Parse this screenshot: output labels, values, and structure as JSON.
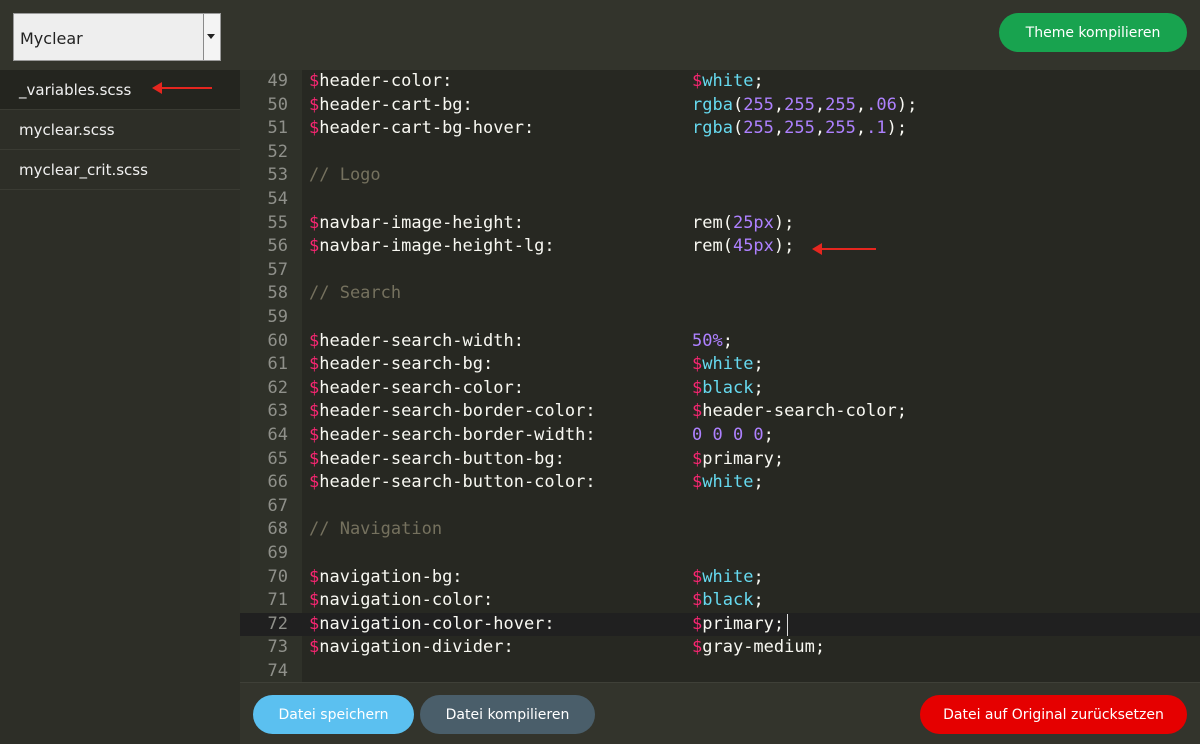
{
  "header": {
    "theme_select": {
      "selected": "Myclear"
    },
    "compile_theme_label": "Theme kompilieren"
  },
  "sidebar": {
    "files": [
      {
        "label": "_variables.scss",
        "active": true
      },
      {
        "label": "myclear.scss",
        "active": false
      },
      {
        "label": "myclear_crit.scss",
        "active": false
      }
    ]
  },
  "editor": {
    "active_line": 72,
    "lines": [
      {
        "n": "49",
        "kind": "var",
        "name": "header-color:",
        "val": [
          [
            "dollar",
            "$"
          ],
          [
            "kw",
            "white"
          ],
          [
            "plain",
            ";"
          ]
        ]
      },
      {
        "n": "50",
        "kind": "var",
        "name": "header-cart-bg:",
        "val": [
          [
            "kw",
            "rgba"
          ],
          [
            "plain",
            "("
          ],
          [
            "num",
            "255"
          ],
          [
            "plain",
            ","
          ],
          [
            "num",
            "255"
          ],
          [
            "plain",
            ","
          ],
          [
            "num",
            "255"
          ],
          [
            "plain",
            ","
          ],
          [
            "num",
            ".06"
          ],
          [
            "plain",
            ");"
          ]
        ]
      },
      {
        "n": "51",
        "kind": "var",
        "name": "header-cart-bg-hover:",
        "val": [
          [
            "kw",
            "rgba"
          ],
          [
            "plain",
            "("
          ],
          [
            "num",
            "255"
          ],
          [
            "plain",
            ","
          ],
          [
            "num",
            "255"
          ],
          [
            "plain",
            ","
          ],
          [
            "num",
            "255"
          ],
          [
            "plain",
            ","
          ],
          [
            "num",
            ".1"
          ],
          [
            "plain",
            ");"
          ]
        ]
      },
      {
        "n": "52",
        "kind": "blank"
      },
      {
        "n": "53",
        "kind": "comment",
        "text": "// Logo"
      },
      {
        "n": "54",
        "kind": "blank"
      },
      {
        "n": "55",
        "kind": "var",
        "name": "navbar-image-height:",
        "val": [
          [
            "plain",
            "rem("
          ],
          [
            "num",
            "25px"
          ],
          [
            "plain",
            ");"
          ]
        ]
      },
      {
        "n": "56",
        "kind": "var",
        "name": "navbar-image-height-lg:",
        "val": [
          [
            "plain",
            "rem("
          ],
          [
            "num",
            "45px"
          ],
          [
            "plain",
            ");"
          ]
        ]
      },
      {
        "n": "57",
        "kind": "blank"
      },
      {
        "n": "58",
        "kind": "comment",
        "text": "// Search"
      },
      {
        "n": "59",
        "kind": "blank"
      },
      {
        "n": "60",
        "kind": "var",
        "name": "header-search-width:",
        "val": [
          [
            "num",
            "50%"
          ],
          [
            "plain",
            ";"
          ]
        ]
      },
      {
        "n": "61",
        "kind": "var",
        "name": "header-search-bg:",
        "val": [
          [
            "dollar",
            "$"
          ],
          [
            "kw",
            "white"
          ],
          [
            "plain",
            ";"
          ]
        ]
      },
      {
        "n": "62",
        "kind": "var",
        "name": "header-search-color:",
        "val": [
          [
            "dollar",
            "$"
          ],
          [
            "kw",
            "black"
          ],
          [
            "plain",
            ";"
          ]
        ]
      },
      {
        "n": "63",
        "kind": "var",
        "name": "header-search-border-color:",
        "val": [
          [
            "dollar",
            "$"
          ],
          [
            "plain",
            "header-search-color;"
          ]
        ]
      },
      {
        "n": "64",
        "kind": "var",
        "name": "header-search-border-width:",
        "val": [
          [
            "num",
            "0 0 0 0"
          ],
          [
            "plain",
            ";"
          ]
        ]
      },
      {
        "n": "65",
        "kind": "var",
        "name": "header-search-button-bg:",
        "val": [
          [
            "dollar",
            "$"
          ],
          [
            "plain",
            "primary;"
          ]
        ]
      },
      {
        "n": "66",
        "kind": "var",
        "name": "header-search-button-color:",
        "val": [
          [
            "dollar",
            "$"
          ],
          [
            "kw",
            "white"
          ],
          [
            "plain",
            ";"
          ]
        ]
      },
      {
        "n": "67",
        "kind": "blank"
      },
      {
        "n": "68",
        "kind": "comment",
        "text": "// Navigation"
      },
      {
        "n": "69",
        "kind": "blank"
      },
      {
        "n": "70",
        "kind": "var",
        "name": "navigation-bg:",
        "val": [
          [
            "dollar",
            "$"
          ],
          [
            "kw",
            "white"
          ],
          [
            "plain",
            ";"
          ]
        ]
      },
      {
        "n": "71",
        "kind": "var",
        "name": "navigation-color:",
        "val": [
          [
            "dollar",
            "$"
          ],
          [
            "kw",
            "black"
          ],
          [
            "plain",
            ";"
          ]
        ]
      },
      {
        "n": "72",
        "kind": "var",
        "name": "navigation-color-hover:",
        "val": [
          [
            "dollar",
            "$"
          ],
          [
            "plain",
            "primary;"
          ]
        ]
      },
      {
        "n": "73",
        "kind": "var",
        "name": "navigation-divider:",
        "val": [
          [
            "dollar",
            "$"
          ],
          [
            "plain",
            "gray-medium;"
          ]
        ]
      },
      {
        "n": "74",
        "kind": "blank"
      }
    ]
  },
  "footer": {
    "save_label": "Datei speichern",
    "compile_file_label": "Datei kompilieren",
    "reset_label": "Datei auf Original zurücksetzen"
  },
  "colors": {
    "compile_theme": "#18a34f",
    "save": "#5bc0f0",
    "compile_file": "#4a5e6a",
    "reset": "#e50000",
    "annotation_arrow": "#e5261f"
  }
}
